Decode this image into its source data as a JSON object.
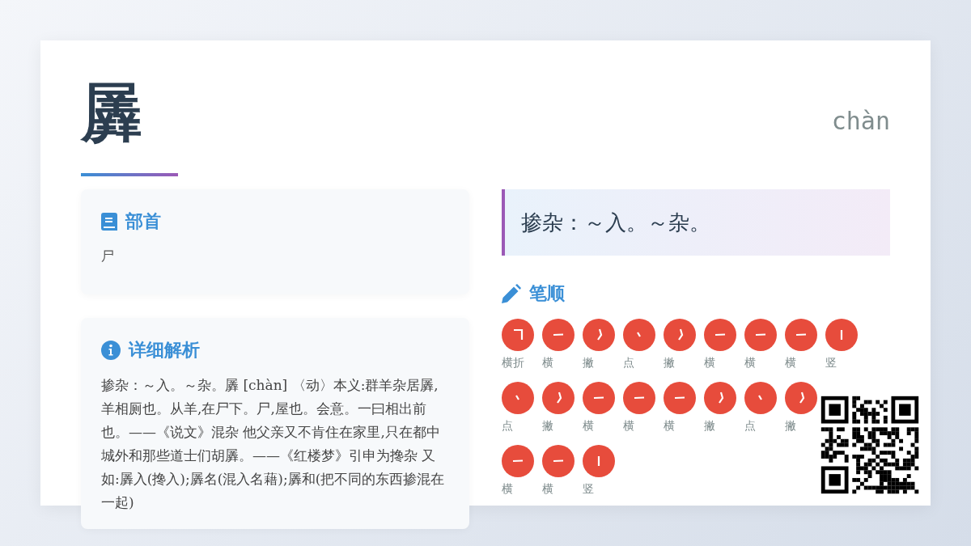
{
  "character": "羼",
  "pinyin": "chàn",
  "radical": {
    "title": "部首",
    "value": "尸"
  },
  "detail": {
    "title": "详细解析",
    "text": "掺杂：～入。～杂。羼 [chàn] 〈动〉本义:群羊杂居羼,羊相厕也。从羊,在尸下。尸,屋也。会意。一曰相出前也。——《说文》混杂 他父亲又不肯住在家里,只在都中城外和那些道士们胡羼。——《红楼梦》引申为搀杂 又如:羼入(搀入);羼名(混入名藉);羼和(把不同的东西掺混在一起)"
  },
  "definition": "掺杂：～入。～杂。",
  "stroke_order": {
    "title": "笔顺",
    "rows": [
      [
        {
          "name": "横折",
          "kind": "hengzhe"
        },
        {
          "name": "横",
          "kind": "heng"
        },
        {
          "name": "撇",
          "kind": "pie"
        },
        {
          "name": "点",
          "kind": "dian"
        },
        {
          "name": "撇",
          "kind": "pie"
        },
        {
          "name": "横",
          "kind": "heng"
        },
        {
          "name": "横",
          "kind": "heng"
        },
        {
          "name": "横",
          "kind": "heng"
        },
        {
          "name": "竖",
          "kind": "shu"
        }
      ],
      [
        {
          "name": "点",
          "kind": "dian"
        },
        {
          "name": "撇",
          "kind": "pie"
        },
        {
          "name": "横",
          "kind": "heng"
        },
        {
          "name": "横",
          "kind": "heng"
        },
        {
          "name": "横",
          "kind": "heng"
        },
        {
          "name": "撇",
          "kind": "pie"
        },
        {
          "name": "点",
          "kind": "dian"
        },
        {
          "name": "撇",
          "kind": "pie"
        }
      ],
      [
        {
          "name": "横",
          "kind": "heng"
        },
        {
          "name": "横",
          "kind": "heng"
        },
        {
          "name": "竖",
          "kind": "shu"
        }
      ]
    ]
  }
}
